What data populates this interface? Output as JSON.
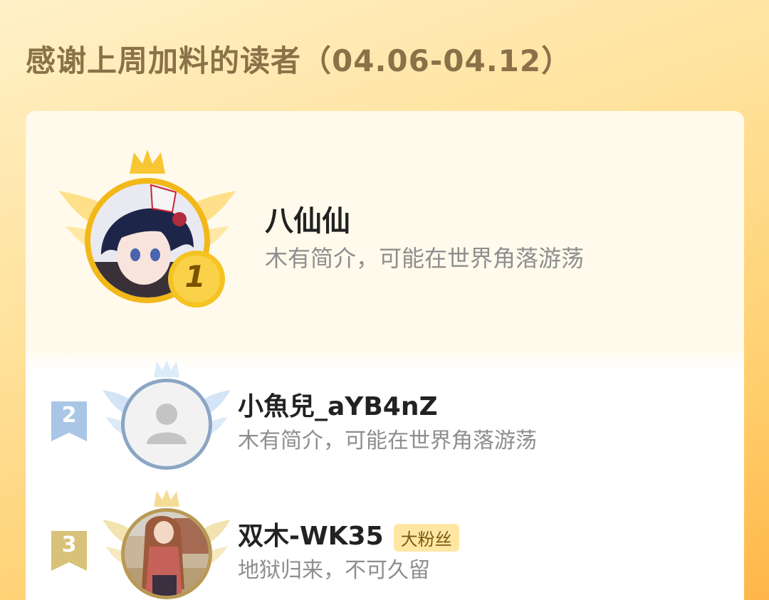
{
  "page_title": "感谢上周加料的读者（04.06-04.12）",
  "colors": {
    "gold": "#f2b81a",
    "silver": "#a9c6e6",
    "bronze": "#d8c27a",
    "badge_bg": "#ffe7a3"
  },
  "readers": [
    {
      "rank": "1",
      "name": "八仙仙",
      "bio": "木有简介，可能在世界角落游荡",
      "badge": "",
      "avatar": "anime-avatar-icon"
    },
    {
      "rank": "2",
      "name": "小魚兒_aYB4nZ",
      "bio": "木有简介，可能在世界角落游荡",
      "badge": "",
      "avatar": "default-user-icon"
    },
    {
      "rank": "3",
      "name": "双木-WK35",
      "bio": "地狱归来，不可久留",
      "badge": "大粉丝",
      "avatar": "photo-avatar-icon"
    }
  ]
}
